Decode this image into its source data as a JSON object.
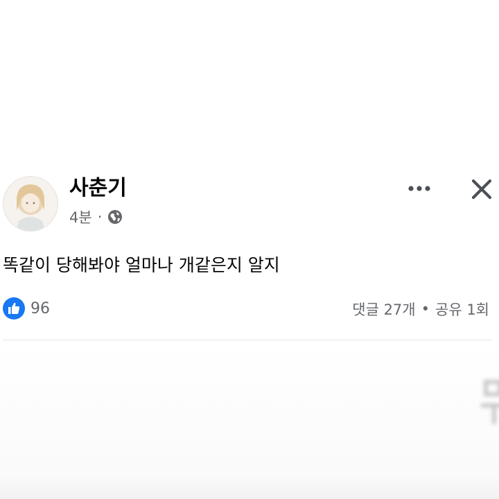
{
  "post": {
    "author": "사춘기",
    "time": "4분",
    "meta_separator": "·",
    "visibility_icon": "globe-icon",
    "text": "똑같이 당해봐야 얼마나 개같은지 알지",
    "reactions": {
      "icon": "like-icon",
      "count": "96"
    },
    "stats": {
      "comments": "댓글 27개",
      "separator": "•",
      "shares": "공유 1회"
    }
  },
  "actions": {
    "more_icon": "more-horizontal-icon",
    "close_icon": "close-icon"
  },
  "colors": {
    "text_primary": "#050505",
    "text_secondary": "#65676b",
    "like_blue": "#1877f2",
    "divider": "#e4e6eb"
  }
}
